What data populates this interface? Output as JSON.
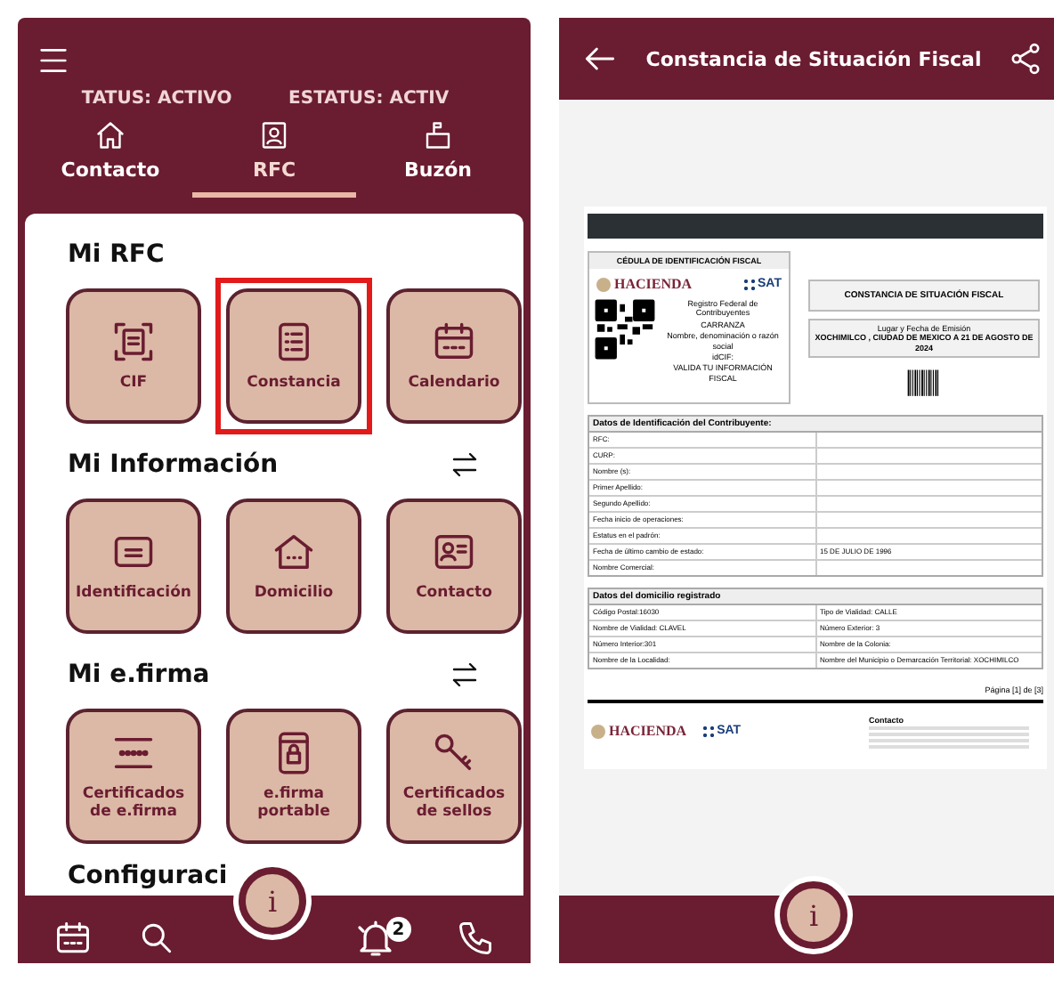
{
  "left_screen": {
    "status_texts": [
      "TATUS: ACTIVO",
      "ESTATUS: ACTIV"
    ],
    "tabs": [
      {
        "label": "Contacto",
        "selected": false
      },
      {
        "label": "RFC",
        "selected": true
      },
      {
        "label": "Buzón",
        "selected": false
      }
    ],
    "sections": [
      {
        "title": "Mi RFC",
        "reorder_toggle": false,
        "tiles": [
          {
            "label": "CIF",
            "highlighted": false
          },
          {
            "label": "Constancia",
            "highlighted": true
          },
          {
            "label": "Calendario",
            "highlighted": false
          }
        ]
      },
      {
        "title": "Mi Información",
        "reorder_toggle": true,
        "tiles": [
          {
            "label": "Identificación",
            "highlighted": false
          },
          {
            "label": "Domicilio",
            "highlighted": false
          },
          {
            "label": "Contacto",
            "highlighted": false
          }
        ]
      },
      {
        "title": "Mi e.firma",
        "reorder_toggle": true,
        "tiles": [
          {
            "label": "Certificados de e.firma",
            "highlighted": false
          },
          {
            "label": "e.firma portable",
            "highlighted": false
          },
          {
            "label": "Certificados de sellos",
            "highlighted": false
          }
        ]
      }
    ],
    "partial_heading": "Configuraci",
    "info_button": "i",
    "notification_badge": "2"
  },
  "right_screen": {
    "title": "Constancia de Situación Fiscal",
    "info_button": "i",
    "document": {
      "cedula_title": "CÉDULA DE IDENTIFICACIÓN FISCAL",
      "logo_hacienda": "HACIENDA",
      "logo_sat": "SAT",
      "registry_text": "Registro Federal de Contribuyentes",
      "name_text": "CARRANZA",
      "name_caption": "Nombre, denominación o razón social",
      "idcif_text": "idCIF:",
      "validate_text": "VALIDA TU INFORMACIÓN FISCAL",
      "constancia_title": "CONSTANCIA DE SITUACIÓN FISCAL",
      "emission_label": "Lugar y Fecha de Emisión",
      "emission_value": "XOCHIMILCO , CIUDAD DE MEXICO A 21 DE AGOSTO DE 2024",
      "identification": {
        "title": "Datos de Identificación del Contribuyente:",
        "rows": [
          {
            "label": "RFC:"
          },
          {
            "label": "CURP:"
          },
          {
            "label": "Nombre (s):"
          },
          {
            "label": "Primer Apellido:"
          },
          {
            "label": "Segundo Apellido:"
          },
          {
            "label": "Fecha inicio de operaciones:"
          },
          {
            "label": "Estatus en el padrón:"
          },
          {
            "label": "Fecha de último cambio de estado:",
            "value": "15 DE JULIO DE 1996"
          },
          {
            "label": "Nombre Comercial:"
          }
        ]
      },
      "address": {
        "title": "Datos del domicilio registrado",
        "rows": [
          [
            "Código Postal:16030",
            "Tipo de Vialidad: CALLE"
          ],
          [
            "Nombre de Vialidad: CLAVEL",
            "Número Exterior: 3"
          ],
          [
            "Número Interior:301",
            "Nombre de la Colonia:"
          ],
          [
            "Nombre de la Localidad:",
            "Nombre del Municipio o Demarcación Territorial: XOCHIMILCO"
          ]
        ]
      },
      "page_number": "Página [1] de [3]",
      "footer_logo_hacienda": "HACIENDA",
      "footer_logo_sat": "SAT",
      "contact_title": "Contacto"
    }
  }
}
